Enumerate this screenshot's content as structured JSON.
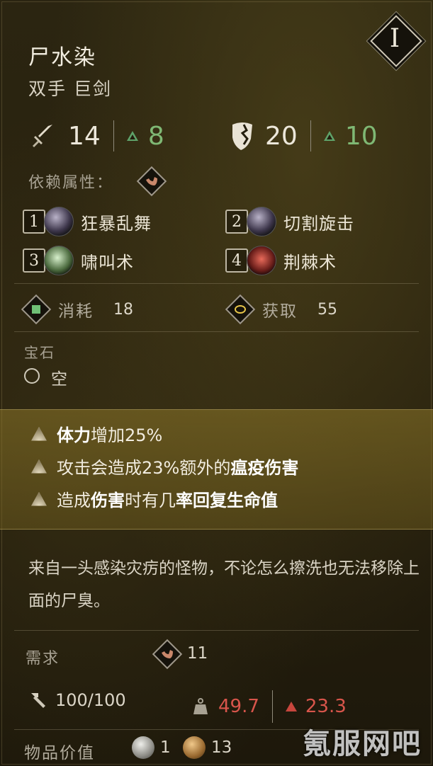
{
  "item": {
    "name": "尸水染",
    "type": "双手 巨剑",
    "tier": "I"
  },
  "stats": {
    "attack": "14",
    "attack_upgrade": "8",
    "guard": "20",
    "guard_upgrade": "10"
  },
  "scaling_label": "依赖属性：",
  "skills": [
    {
      "key": "1",
      "name": "狂暴乱舞"
    },
    {
      "key": "2",
      "name": "切割旋击"
    },
    {
      "key": "3",
      "name": "啸叫术"
    },
    {
      "key": "4",
      "name": "荆棘术"
    }
  ],
  "resources": {
    "consume_label": "消耗",
    "consume_value": "18",
    "gain_label": "获取",
    "gain_value": "55"
  },
  "gem": {
    "label": "宝石",
    "slot": "空"
  },
  "effects": [
    {
      "pre": "",
      "bold1": "体力",
      "mid": "增加25%",
      "bold2": "",
      "post": ""
    },
    {
      "pre": "攻击会造成23%额外的",
      "bold1": "瘟疫伤害",
      "mid": "",
      "bold2": "",
      "post": ""
    },
    {
      "pre": "造成",
      "bold1": "伤害",
      "mid": "时有几",
      "bold2": "率回复生命值",
      "post": ""
    }
  ],
  "description": "来自一头感染灾疠的怪物，不论怎么擦洗也无法移除上面的尸臭。",
  "requirement": {
    "label": "需求",
    "value": "11"
  },
  "durability": "100/100",
  "weight": "49.7",
  "weight_upgrade": "23.3",
  "value": {
    "label": "物品价值",
    "silver": "1",
    "gold": "13"
  },
  "watermark": "氪服网吧",
  "colors": {
    "upgrade_green": "#7fb874",
    "warning_red": "#d8554b",
    "effect_band": "#8c7628"
  }
}
